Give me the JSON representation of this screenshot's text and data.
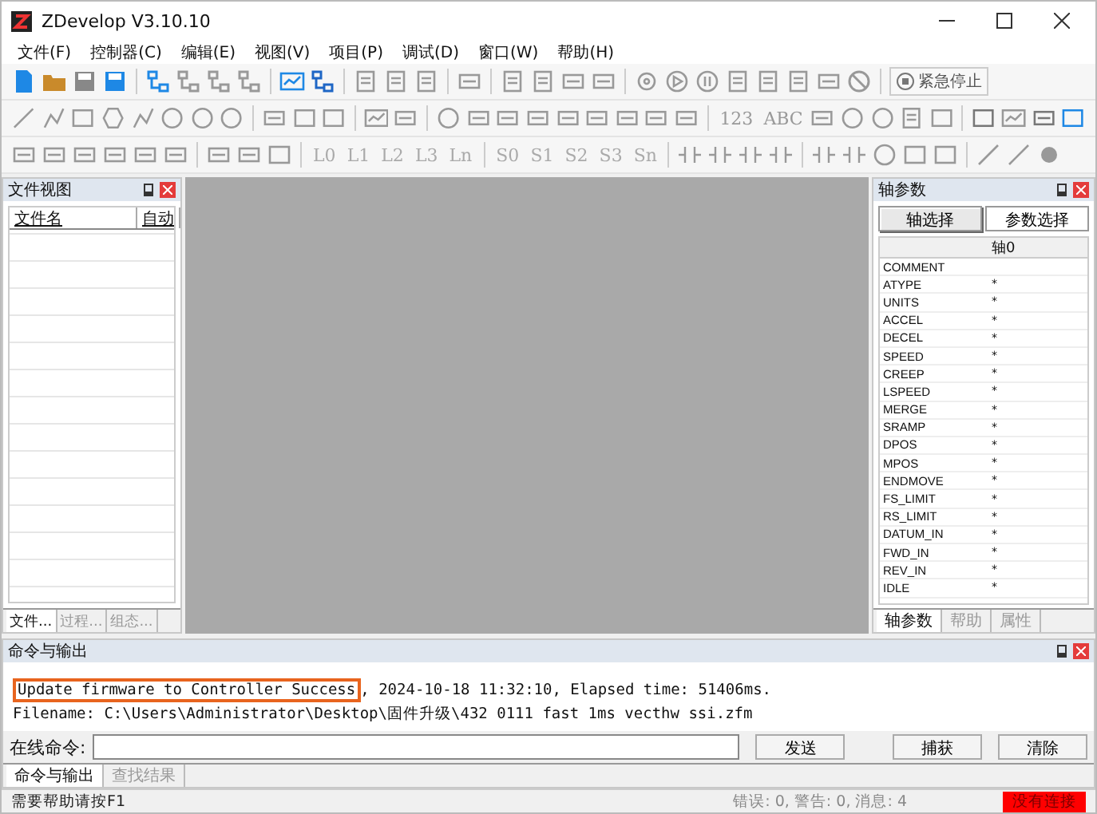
{
  "window": {
    "title": "ZDevelop V3.10.10"
  },
  "menu": [
    "文件(F)",
    "控制器(C)",
    "编辑(E)",
    "视图(V)",
    "项目(P)",
    "调试(D)",
    "窗口(W)",
    "帮助(H)"
  ],
  "toolbar": {
    "emergency_stop": "紧急停止",
    "number_label": "123",
    "text_label": "ABC",
    "l_buttons": [
      "L0",
      "L1",
      "L2",
      "L3",
      "Ln"
    ],
    "s_buttons": [
      "S0",
      "S1",
      "S2",
      "S3",
      "Sn"
    ]
  },
  "file_view": {
    "title": "文件视图",
    "columns": [
      "文件名",
      "自动"
    ],
    "tabs": [
      {
        "label": "文件...",
        "selected": true
      },
      {
        "label": "过程...",
        "selected": false
      },
      {
        "label": "组态...",
        "selected": false
      }
    ]
  },
  "axis_params": {
    "title": "轴参数",
    "buttons": [
      {
        "label": "轴选择",
        "selected": true
      },
      {
        "label": "参数选择",
        "selected": false
      }
    ],
    "column": "轴0",
    "rows": [
      {
        "name": "COMMENT",
        "value": ""
      },
      {
        "name": "ATYPE",
        "value": "*"
      },
      {
        "name": "UNITS",
        "value": "*"
      },
      {
        "name": "ACCEL",
        "value": "*"
      },
      {
        "name": "DECEL",
        "value": "*"
      },
      {
        "name": "SPEED",
        "value": "*"
      },
      {
        "name": "CREEP",
        "value": "*"
      },
      {
        "name": "LSPEED",
        "value": "*"
      },
      {
        "name": "MERGE",
        "value": "*"
      },
      {
        "name": "SRAMP",
        "value": "*"
      },
      {
        "name": "DPOS",
        "value": "*"
      },
      {
        "name": "MPOS",
        "value": "*"
      },
      {
        "name": "ENDMOVE",
        "value": "*"
      },
      {
        "name": "FS_LIMIT",
        "value": "*"
      },
      {
        "name": "RS_LIMIT",
        "value": "*"
      },
      {
        "name": "DATUM_IN",
        "value": "*"
      },
      {
        "name": "FWD_IN",
        "value": "*"
      },
      {
        "name": "REV_IN",
        "value": "*"
      },
      {
        "name": "IDLE",
        "value": "*"
      }
    ],
    "tabs": [
      {
        "label": "轴参数",
        "selected": true
      },
      {
        "label": "帮助",
        "selected": false
      },
      {
        "label": "属性",
        "selected": false
      }
    ]
  },
  "output": {
    "title": "命令与输出",
    "highlighted": "Update firmware to Controller Success",
    "line_1_rest": ", 2024-10-18 11:32:10, Elapsed time: 51406ms.",
    "line_2": "Filename: C:\\Users\\Administrator\\Desktop\\固件升级\\432 0111 fast 1ms vecthw ssi.zfm",
    "command_label": "在线命令:",
    "buttons": [
      "发送",
      "捕获",
      "清除"
    ],
    "tabs": [
      {
        "label": "命令与输出",
        "selected": true
      },
      {
        "label": "查找结果",
        "selected": false
      }
    ]
  },
  "status_bar": {
    "hint": "需要帮助请按F1",
    "counts": "错误: 0, 警告: 0, 消息: 4",
    "connection": "没有连接"
  }
}
